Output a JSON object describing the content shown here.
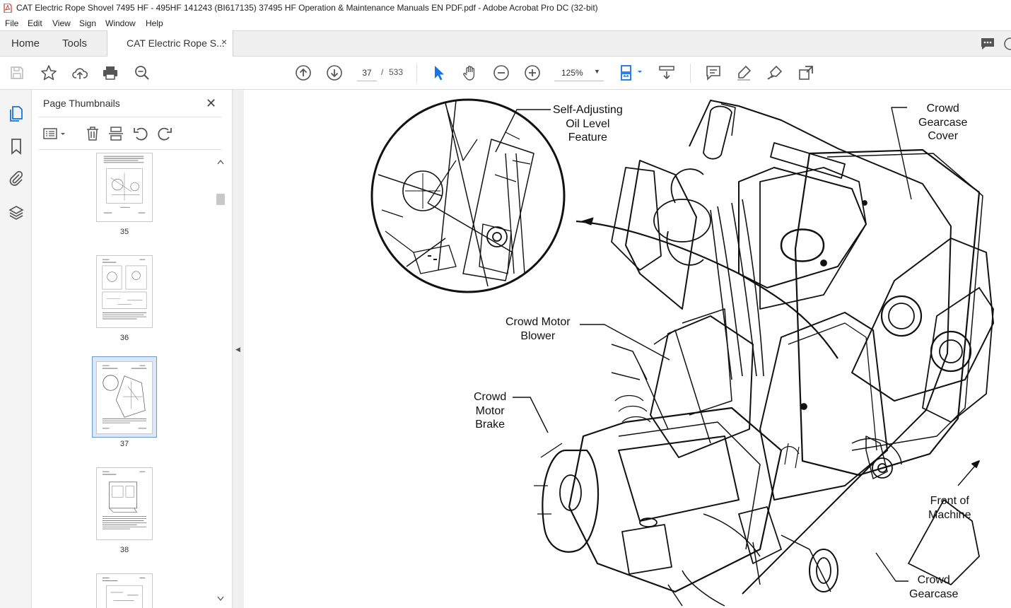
{
  "window": {
    "title": "CAT Electric Rope Shovel 7495 HF - 495HF 141243 (BI617135) 37495 HF Operation & Maintenance Manuals EN PDF.pdf - Adobe Acrobat Pro DC (32-bit)"
  },
  "menu": {
    "items": [
      "File",
      "Edit",
      "View",
      "Sign",
      "Window",
      "Help"
    ]
  },
  "tabs": {
    "home": "Home",
    "tools": "Tools",
    "doc": "CAT Electric Rope S...",
    "close": "×"
  },
  "toolbar": {
    "page_current": "37",
    "page_sep": "/",
    "page_total": "533",
    "zoom": "125%"
  },
  "panel": {
    "title": "Page Thumbnails",
    "close": "✕"
  },
  "thumbnails": [
    {
      "number": "35"
    },
    {
      "number": "36"
    },
    {
      "number": "37",
      "selected": true
    },
    {
      "number": "38"
    }
  ],
  "document": {
    "callouts": {
      "self_adjusting": [
        "Self-Adjusting",
        "Oil Level",
        "Feature"
      ],
      "gearcase_cover": [
        "Crowd",
        "Gearcase",
        "Cover"
      ],
      "motor_blower": [
        "Crowd Motor",
        "Blower"
      ],
      "motor_brake": [
        "Crowd",
        "Motor",
        "Brake"
      ],
      "front": [
        "Front of",
        "Machine"
      ],
      "gearcase": [
        "Crowd",
        "Gearcase"
      ]
    }
  },
  "colors": {
    "accent": "#1473e6",
    "selection": "#dbe7f5",
    "pdf_icon": "#d8321f"
  }
}
